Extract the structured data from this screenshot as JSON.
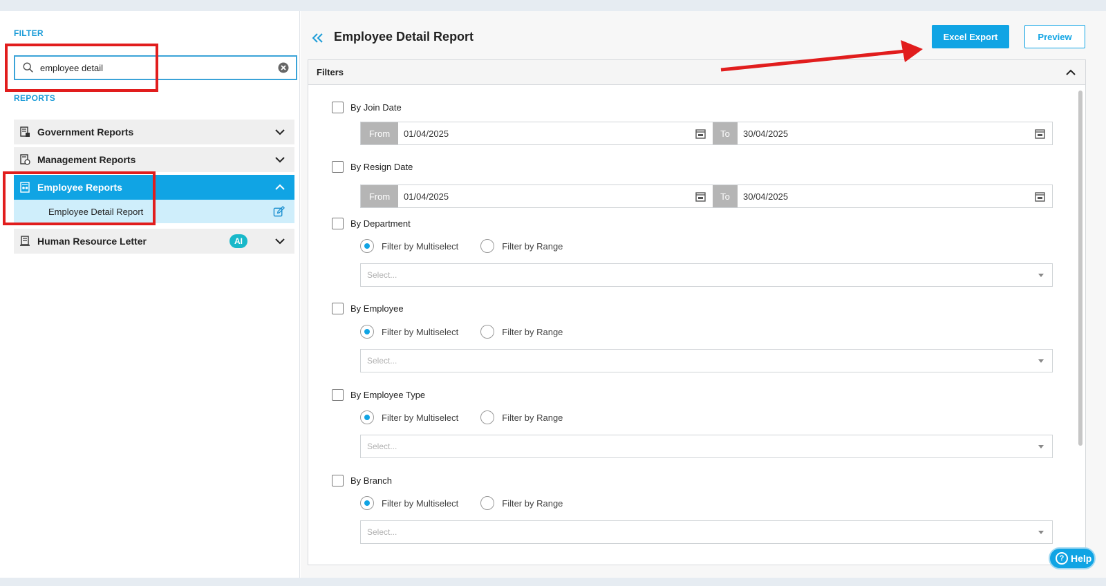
{
  "sidebar": {
    "filter_label": "FILTER",
    "search": {
      "value": "employee detail",
      "placeholder": ""
    },
    "reports_label": "REPORTS",
    "groups": [
      {
        "label": "Government Reports",
        "icon": "report-icon",
        "expanded": false
      },
      {
        "label": "Management Reports",
        "icon": "report-clock-icon",
        "expanded": false
      },
      {
        "label": "Employee Reports",
        "icon": "employee-report-icon",
        "expanded": true,
        "items": [
          {
            "label": "Employee Detail Report"
          }
        ]
      },
      {
        "label": "Human Resource Letter",
        "icon": "letter-icon",
        "expanded": false,
        "badge": "AI"
      }
    ]
  },
  "header": {
    "title": "Employee Detail Report",
    "excel_export_label": "Excel Export",
    "preview_label": "Preview"
  },
  "filters": {
    "title": "Filters",
    "join_date": {
      "label": "By Join Date",
      "from_label": "From",
      "from_value": "01/04/2025",
      "to_label": "To",
      "to_value": "30/04/2025"
    },
    "resign_date": {
      "label": "By Resign Date",
      "from_label": "From",
      "from_value": "01/04/2025",
      "to_label": "To",
      "to_value": "30/04/2025"
    },
    "sections": [
      {
        "label": "By Department",
        "opt1": "Filter by Multiselect",
        "opt2": "Filter by Range",
        "placeholder": "Select..."
      },
      {
        "label": "By Employee",
        "opt1": "Filter by Multiselect",
        "opt2": "Filter by Range",
        "placeholder": "Select..."
      },
      {
        "label": "By Employee Type",
        "opt1": "Filter by Multiselect",
        "opt2": "Filter by Range",
        "placeholder": "Select..."
      },
      {
        "label": "By Branch",
        "opt1": "Filter by Multiselect",
        "opt2": "Filter by Range",
        "placeholder": "Select..."
      }
    ]
  },
  "help": {
    "label": "Help"
  },
  "colors": {
    "accent": "#10a4e4",
    "highlight": "#e11d1d",
    "sub_item_bg": "#cfeefb"
  }
}
